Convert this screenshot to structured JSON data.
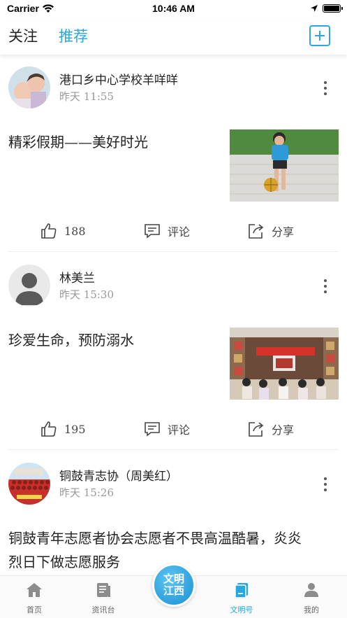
{
  "status_bar": {
    "carrier": "Carrier",
    "time": "10:46 AM"
  },
  "nav": {
    "tab_follow": "关注",
    "tab_recommend": "推荐",
    "add_icon": "plus-square-icon"
  },
  "posts": [
    {
      "author": "港口乡中心学校羊咩咩",
      "date": "昨天 11:55",
      "title": "精彩假期——美好时光",
      "likes": "188",
      "comment_label": "评论",
      "share_label": "分享"
    },
    {
      "author": "林美兰",
      "date": "昨天 15:30",
      "title": "珍爱生命，预防溺水",
      "likes": "195",
      "comment_label": "评论",
      "share_label": "分享"
    },
    {
      "author": "铜鼓青志协（周美红）",
      "date": "昨天 15:26",
      "title_line1": "铜鼓青年志愿者协会志愿者不畏高温酷暑，炎炎",
      "title_line2": "烈日下做志愿服务"
    }
  ],
  "bottom_nav": {
    "home": "首页",
    "news": "资讯台",
    "logo_line1": "文明",
    "logo_line2": "江西",
    "wmh": "文明号",
    "me": "我的"
  },
  "colors": {
    "accent": "#29a7de"
  }
}
